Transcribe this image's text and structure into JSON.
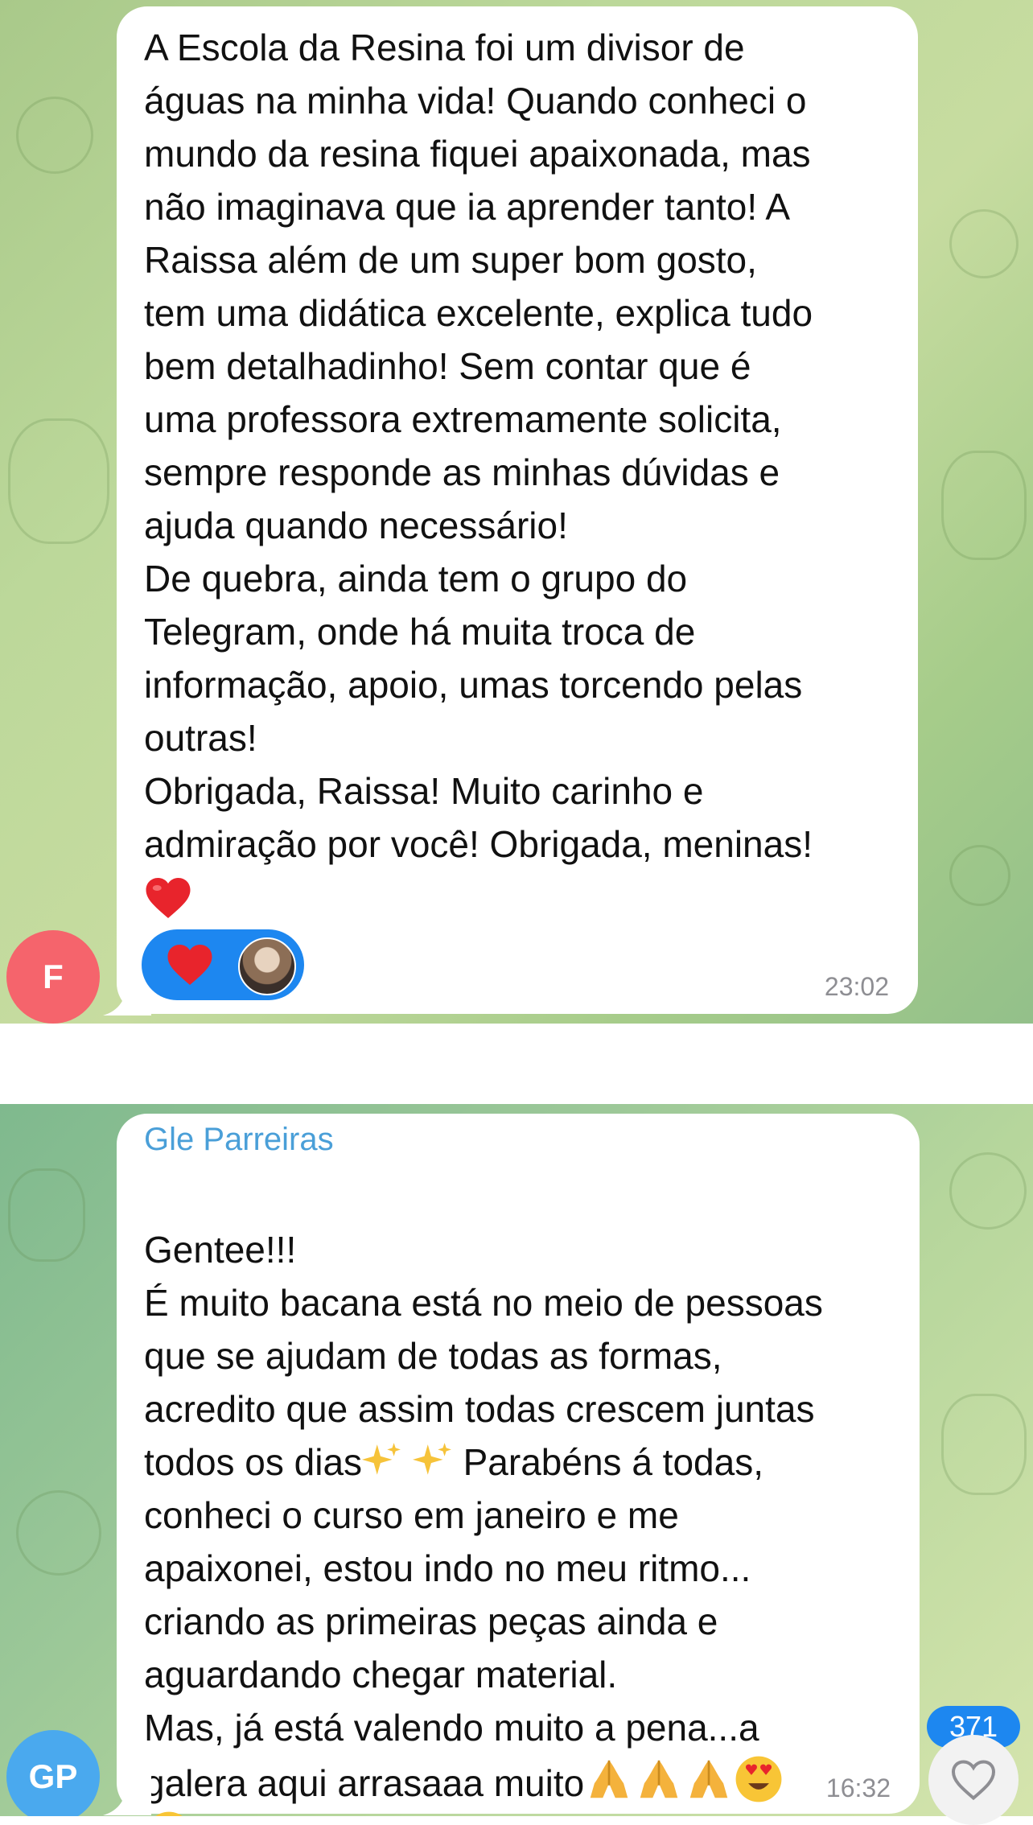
{
  "messages": [
    {
      "avatar_initials": "F",
      "avatar_color": "#f5646c",
      "text": "A Escola da Resina foi um divisor de\náguas na minha vida! Quando conheci o\nmundo da resina fiquei apaixonada, mas\nnão imaginava que ia aprender tanto! A\nRaissa além de um super bom gosto,\ntem uma didática excelente, explica tudo\nbem detalhadinho! Sem contar que é\numa professora extremamente solicita,\nsempre responde as minhas dúvidas e\najuda quando necessário!\nDe quebra, ainda tem o grupo do\nTelegram, onde há muita troca de\ninformação, apoio, umas torcendo pelas\noutras!\nObrigada, Raissa! Muito carinho e\nadmiração por você! Obrigada, meninas!",
      "trailing_emoji": "heart-emoji",
      "reaction": {
        "emoji": "heart-emoji",
        "by": "reactor-avatar"
      },
      "time": "23:02"
    },
    {
      "sender": "Gle Parreiras",
      "sender_color": "#4a9fd8",
      "avatar_initials": "GP",
      "avatar_color": "#4aa9ee",
      "text_line1": "Gentee!!!\nÉ muito bacana está no meio de pessoas\nque se ajudam de todas as formas,\nacredito que assim todas crescem juntas",
      "text_line_sparkle_before": "todos os dias",
      "text_line_sparkle_after": " Parabéns á todas,",
      "text_line2": "conheci o curso em janeiro e me\napaixonei, estou indo no meu ritmo...\ncriando as primeiras peças ainda e\naguardando chegar material.\nMas, já está valendo muito a pena...a",
      "text_last_line": "galera aqui arrasaaa muito",
      "emojis": [
        "folded-hands-emoji",
        "folded-hands-emoji",
        "folded-hands-emoji",
        "heart-eyes-emoji"
      ],
      "time": "16:32"
    }
  ],
  "like_counter": "371",
  "colors": {
    "accent": "#1d87f0",
    "bubble": "#ffffff",
    "time": "#8e8e93"
  }
}
